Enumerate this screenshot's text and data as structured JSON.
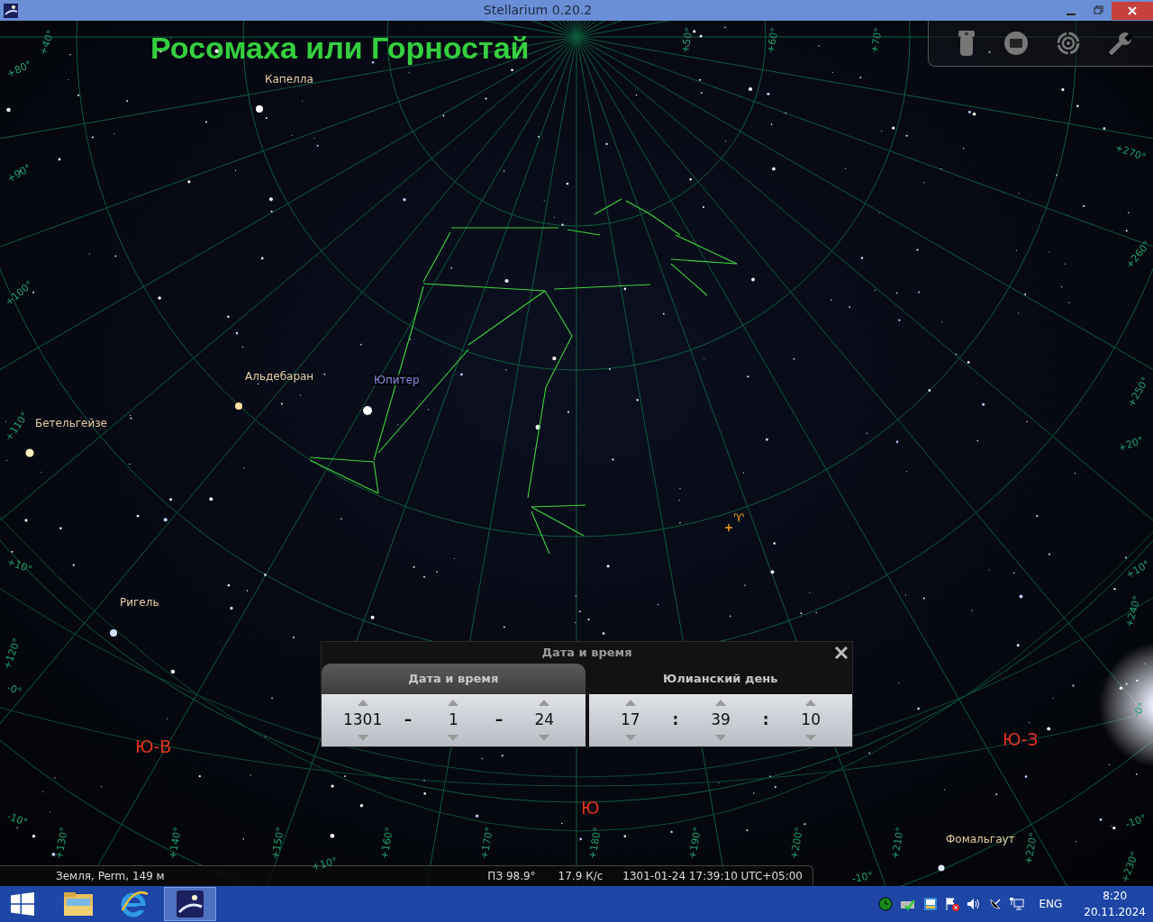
{
  "window": {
    "title": "Stellarium 0.20.2"
  },
  "sky": {
    "title": "Росомаха или Горностай",
    "star_labels": [
      {
        "text": "Капелла",
        "kind": "star"
      },
      {
        "text": "Альдебаран",
        "kind": "star"
      },
      {
        "text": "Юпитер",
        "kind": "planet"
      },
      {
        "text": "Бетельгейзе",
        "kind": "star"
      },
      {
        "text": "Ригель",
        "kind": "star"
      },
      {
        "text": "Фомальгаут",
        "kind": "star"
      }
    ],
    "cardinals": [
      "Ю-В",
      "Ю",
      "Ю-З"
    ],
    "vernal_point": "♈",
    "grid_labels": [
      "+40°",
      "+80°",
      "+90°",
      "+100°",
      "+110°",
      "+10°",
      "-0°",
      "-10°",
      "+50°",
      "+60°",
      "+70°",
      "+270°",
      "+260°",
      "+250°",
      "+20°",
      "+10°",
      "+240°",
      "-0°",
      "-10°",
      "+230°",
      "+220°",
      "+210°",
      "+200°",
      "+190°",
      "+180°",
      "+170°",
      "+160°",
      "+150°",
      "+140°",
      "+130°",
      "+120°",
      "+10°",
      "-10°"
    ]
  },
  "dialog": {
    "title": "Дата и время",
    "tabs": [
      {
        "label": "Дата и время",
        "selected": true
      },
      {
        "label": "Юлианский день",
        "selected": false
      }
    ],
    "date": {
      "values": [
        "1301",
        "1",
        "24"
      ],
      "separators": [
        "–",
        "–"
      ]
    },
    "time": {
      "values": [
        "17",
        "39",
        "10"
      ],
      "separators": [
        ":",
        ":"
      ]
    }
  },
  "status_bar": {
    "location": "Земля, Perm, 149 м",
    "fov": "ПЗ 98.9°",
    "fps": "17.9 К/с",
    "datetime": "1301-01-24 17:39:10 UTC+05:00"
  },
  "taskbar": {
    "apps": [
      {
        "kind": "explorer",
        "selected": false
      },
      {
        "kind": "browser",
        "selected": false
      },
      {
        "kind": "stellarium",
        "selected": true
      }
    ],
    "language": "ENG",
    "time": "8:20",
    "date": "20.11.2024"
  }
}
